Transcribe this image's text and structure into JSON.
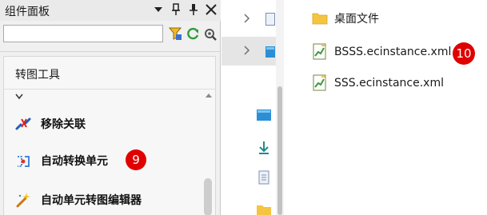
{
  "panel": {
    "title": "组件面板",
    "header_icons": [
      "chevron-down-icon",
      "pin-icon",
      "pin-icon",
      "close-icon"
    ],
    "search": {
      "value": "",
      "placeholder": ""
    },
    "toolbar_icons": [
      "filter-icon",
      "refresh-icon",
      "settings-wrench-icon"
    ],
    "group_title": "转图工具",
    "items": [
      {
        "label": "移除关联",
        "icon": "unlink-icon"
      },
      {
        "label": "自动转换单元",
        "icon": "auto-convert-icon"
      },
      {
        "label": "自动单元转图编辑器",
        "icon": "magic-wand-icon"
      }
    ]
  },
  "badges": {
    "item_badge": "9",
    "file_badge": "10"
  },
  "files": [
    {
      "name": "桌面文件",
      "icon": "folder-icon"
    },
    {
      "name": "BSSS.ecinstance.xml",
      "icon": "xml-file-icon"
    },
    {
      "name": "SSS.ecinstance.xml",
      "icon": "xml-file-icon"
    }
  ],
  "colors": {
    "badge": "#e00000",
    "folder": "#f5c542",
    "selection": "#e5e5e5"
  }
}
